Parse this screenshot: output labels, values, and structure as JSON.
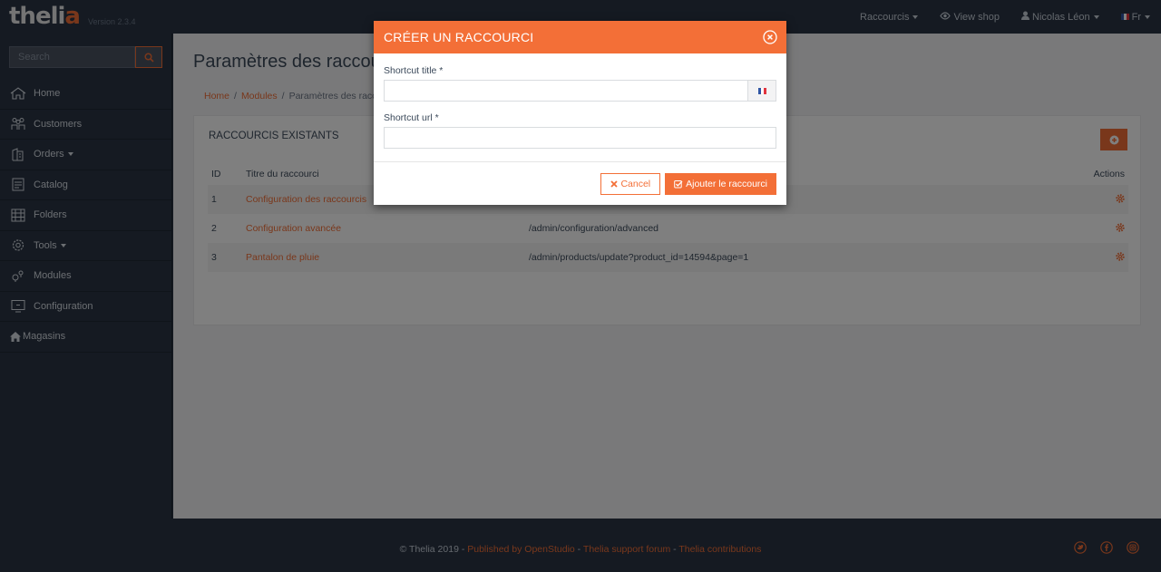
{
  "brand": {
    "logo_pre": "theli",
    "logo_accent": "a",
    "version": "Version 2.3.4"
  },
  "topnav": {
    "shortcuts": "Raccourcis",
    "view_shop": "View shop",
    "user": "Nicolas Léon",
    "lang": "Fr"
  },
  "sidebar": {
    "search_placeholder": "Search",
    "items": [
      {
        "label": "Home",
        "icon": "home-icon"
      },
      {
        "label": "Customers",
        "icon": "customers-icon"
      },
      {
        "label": "Orders",
        "icon": "orders-icon",
        "dropdown": true
      },
      {
        "label": "Catalog",
        "icon": "catalog-icon"
      },
      {
        "label": "Folders",
        "icon": "folders-icon"
      },
      {
        "label": "Tools",
        "icon": "tools-icon",
        "dropdown": true
      },
      {
        "label": "Modules",
        "icon": "modules-icon"
      },
      {
        "label": "Configuration",
        "icon": "configuration-icon"
      },
      {
        "label": "Magasins",
        "icon": "magasins-icon"
      }
    ]
  },
  "main": {
    "title": "Paramètres des raccourcis",
    "breadcrumb": [
      "Home",
      "Modules",
      "Paramètres des raccourcis"
    ],
    "panel_title": "RACCOURCIS EXISTANTS",
    "table": {
      "headers": {
        "id": "ID",
        "title": "Titre du raccourci",
        "actions": "Actions"
      },
      "rows": [
        {
          "id": "1",
          "title": "Configuration des raccourcis",
          "url": ""
        },
        {
          "id": "2",
          "title": "Configuration avancée",
          "url": "/admin/configuration/advanced"
        },
        {
          "id": "3",
          "title": "Pantalon de pluie",
          "url": "/admin/products/update?product_id=14594&page=1"
        }
      ]
    }
  },
  "modal": {
    "title": "CRÉER UN RACCOURCI",
    "title_label": "Shortcut title *",
    "title_value": "",
    "url_label": "Shortcut url *",
    "url_value": "",
    "cancel": "Cancel",
    "submit": "Ajouter le raccourci"
  },
  "footer": {
    "copyright": "© Thelia 2019 - ",
    "link1": "Published by OpenStudio",
    "sep1": " - ",
    "link2": "Thelia support forum",
    "sep2": " - ",
    "link3": "Thelia contributions",
    "social": [
      "twitter-icon",
      "facebook-icon",
      "google-plus-icon"
    ]
  },
  "colors": {
    "accent": "#f36f37",
    "dark": "#2a3545",
    "text": "#3c4a5b"
  }
}
